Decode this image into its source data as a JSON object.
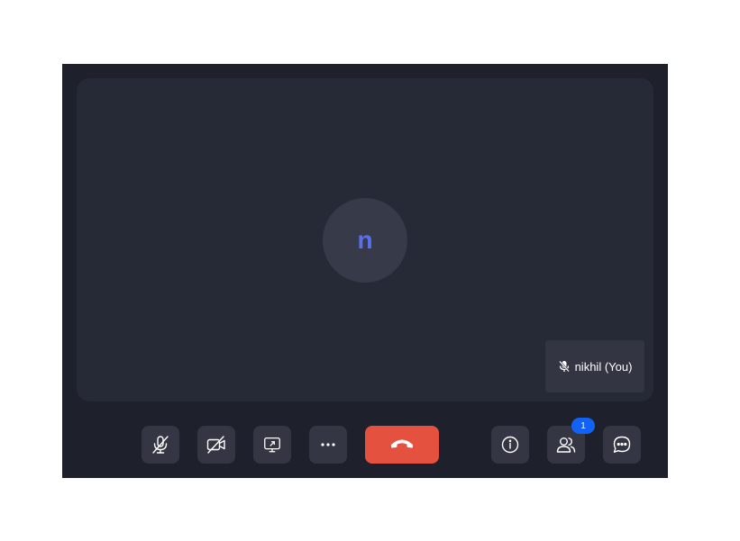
{
  "participant": {
    "initial": "n",
    "self_label": "nikhil (You)"
  },
  "controls": {
    "mic": "mic-off-icon",
    "camera": "camera-off-icon",
    "share": "screen-share-icon",
    "more": "more-icon",
    "end_call": "end-call-icon",
    "info": "info-icon",
    "participants": "participants-icon",
    "participants_count": "1",
    "chat": "chat-icon"
  },
  "colors": {
    "window_bg": "#1e202c",
    "stage_bg": "#262936",
    "avatar_bg": "#373a49",
    "avatar_text": "#5a6ff0",
    "control_bg": "#343644",
    "end_call_bg": "#e5513f",
    "badge_bg": "#1462f5"
  }
}
